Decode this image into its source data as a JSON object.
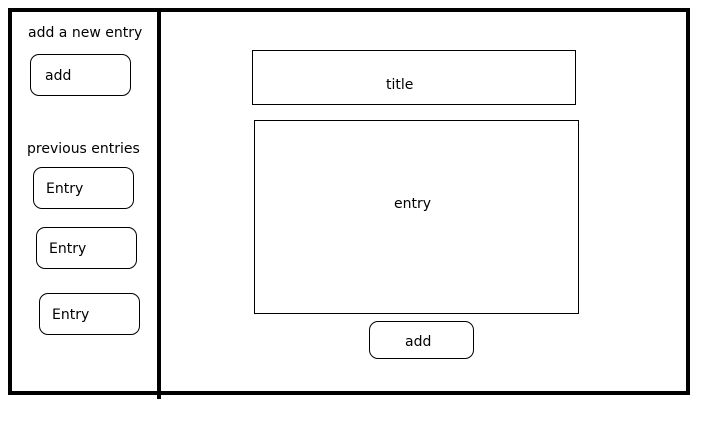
{
  "sidebar": {
    "new_entry_heading": "add a new entry",
    "add_button_label": "add",
    "previous_heading": "previous entries",
    "entries": [
      {
        "label": "Entry"
      },
      {
        "label": "Entry"
      },
      {
        "label": "Entry"
      }
    ]
  },
  "main": {
    "title_placeholder": "title",
    "entry_placeholder": "entry",
    "add_button_label": "add"
  }
}
